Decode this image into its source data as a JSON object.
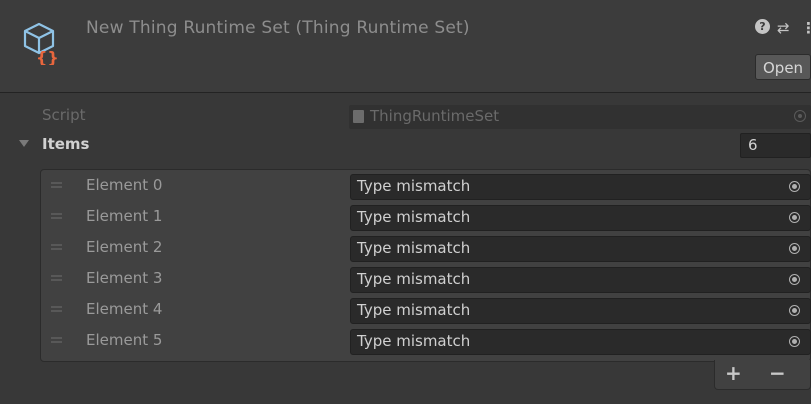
{
  "header": {
    "title": "New Thing Runtime Set (Thing Runtime Set)",
    "asset_icon": "scriptable-object-icon",
    "help_icon": "?",
    "preset_icon": "⇄",
    "more_icon": "⋮",
    "open_label": "Open"
  },
  "script": {
    "label": "Script",
    "value": "ThingRuntimeSet"
  },
  "items": {
    "label": "Items",
    "count": "6",
    "elements": [
      {
        "label": "Element 0",
        "value": "Type mismatch"
      },
      {
        "label": "Element 1",
        "value": "Type mismatch"
      },
      {
        "label": "Element 2",
        "value": "Type mismatch"
      },
      {
        "label": "Element 3",
        "value": "Type mismatch"
      },
      {
        "label": "Element 4",
        "value": "Type mismatch"
      },
      {
        "label": "Element 5",
        "value": "Type mismatch"
      }
    ],
    "add_label": "+",
    "remove_label": "−"
  },
  "colors": {
    "background": "#383838",
    "header": "#3c3c3c",
    "field": "#2a2a2a",
    "asset_icon_blue": "#8fc3e6",
    "asset_icon_orange": "#e8663d"
  }
}
